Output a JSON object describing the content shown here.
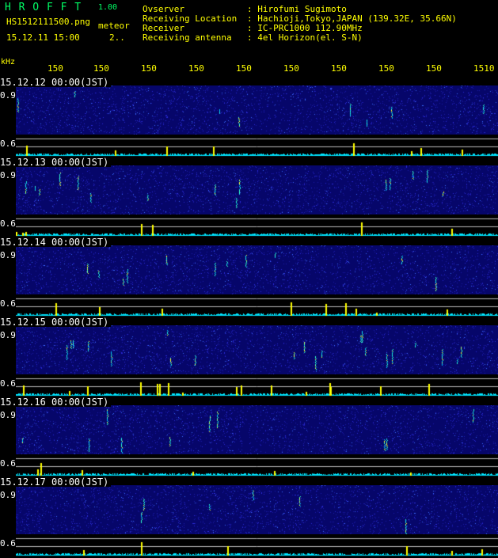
{
  "header": {
    "logo": "H R O F F T",
    "version": "1.00",
    "filename": "HS1512111500.png",
    "mode": "meteor",
    "datetime": "15.12.11 15:00",
    "interval": "2..",
    "info": [
      {
        "key": "Ovserver",
        "value": ": Hirofumi Sugimoto"
      },
      {
        "key": "Receiving Location",
        "value": ": Hachioji,Tokyo,JAPAN (139.32E, 35.66N)"
      },
      {
        "key": "Receiver",
        "value": ": IC-PRC1000 112.90MHz"
      },
      {
        "key": "Receiving antenna",
        "value": ": 4el Horizon(el. S-N)"
      }
    ]
  },
  "freq_axis": {
    "unit": "kHz",
    "ticks": [
      "150",
      "150",
      "150",
      "150",
      "150",
      "150",
      "150",
      "150",
      "150",
      "1510"
    ]
  },
  "panels": [
    {
      "date": "15.12.12 00:00(JST)",
      "level_high": "0.9",
      "level_low": "0.6"
    },
    {
      "date": "15.12.13 00:00(JST)",
      "level_high": "0.9",
      "level_low": "0.6"
    },
    {
      "date": "15.12.14 00:00(JST)",
      "level_high": "0.9",
      "level_low": "0.6"
    },
    {
      "date": "15.12.15 00:00(JST)",
      "level_high": "0.9",
      "level_low": "0.6"
    },
    {
      "date": "15.12.16 00:00(JST)",
      "level_high": "0.9",
      "level_low": "0.6"
    },
    {
      "date": "15.12.17 00:00(JST)",
      "level_high": "0.9",
      "level_low": "0.6"
    }
  ],
  "colors": {
    "background": "#000000",
    "spectrogram": "#06066a",
    "baseline": "#00e5ff",
    "peak": "#ffff00",
    "logo": "#00ff66",
    "label": "#ffff00"
  }
}
